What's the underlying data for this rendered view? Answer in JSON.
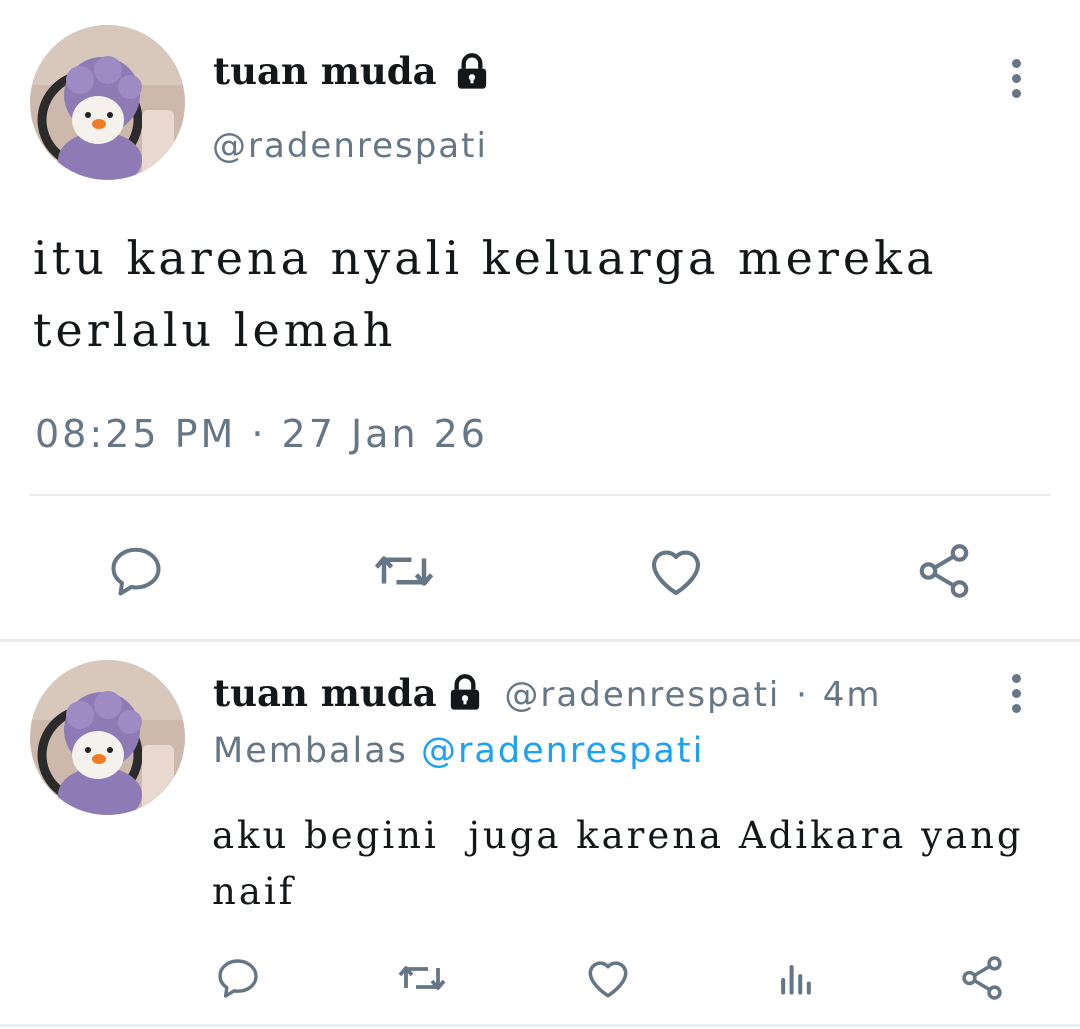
{
  "main_tweet": {
    "display_name": "tuan muda",
    "handle": "@radenrespati",
    "text_line1": "itu karena nyali keluarga mereka",
    "text_line2": "terlalu lemah",
    "timestamp": "08:25 PM · 27 Jan 26"
  },
  "reply": {
    "display_name": "tuan muda",
    "handle": "@radenrespati",
    "separator": "·",
    "age": "4m",
    "replying_prefix": "Membalas",
    "replying_to": "@radenrespati",
    "text_line1": "aku begini  juga karena Adikara yang",
    "text_line2": "naif"
  },
  "icons": {
    "reply": "speech-bubble-icon",
    "retweet": "retweet-icon",
    "like": "heart-icon",
    "share": "share-icon",
    "analytics": "bar-chart-icon",
    "more": "vertical-dots-icon",
    "lock": "lock-icon"
  },
  "colors": {
    "text": "#14171a",
    "muted": "#657786",
    "link": "#1da1f2",
    "divider": "#e6ecf0",
    "avatar_bg": "#c9b6a8",
    "avatar_accent": "#8e7bb5"
  }
}
